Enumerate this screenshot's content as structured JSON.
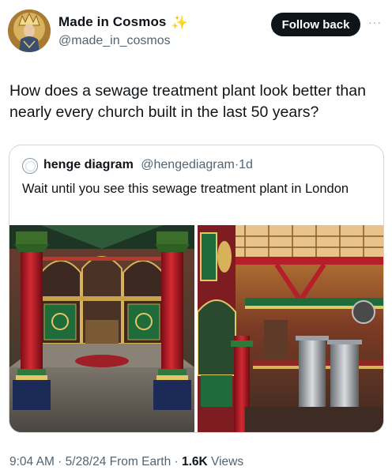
{
  "author": {
    "display_name": "Made in Cosmos",
    "sparkle_glyph": "✨",
    "handle": "@made_in_cosmos"
  },
  "actions": {
    "follow_label": "Follow back",
    "more_glyph": "···"
  },
  "tweet": {
    "text": "How does a sewage treatment plant look better than nearly every church built in the last 50 years?"
  },
  "quote": {
    "name": "henge diagram",
    "handle": "@hengediagram",
    "separator": "·",
    "time": "1d",
    "text": "Wait until you see this sewage treatment plant in London"
  },
  "meta": {
    "time": "9:04 AM",
    "sep1": " · ",
    "date": "5/28/24",
    "via": " From Earth",
    "sep2": " · ",
    "views_count": "1.6K",
    "views_label": " Views"
  },
  "colors": {
    "follow_bg": "#0f1419",
    "secondary_text": "#536471",
    "border": "#cfd9de",
    "column_red": "#c0212b",
    "ironwork_green": "#1f6b3a"
  }
}
